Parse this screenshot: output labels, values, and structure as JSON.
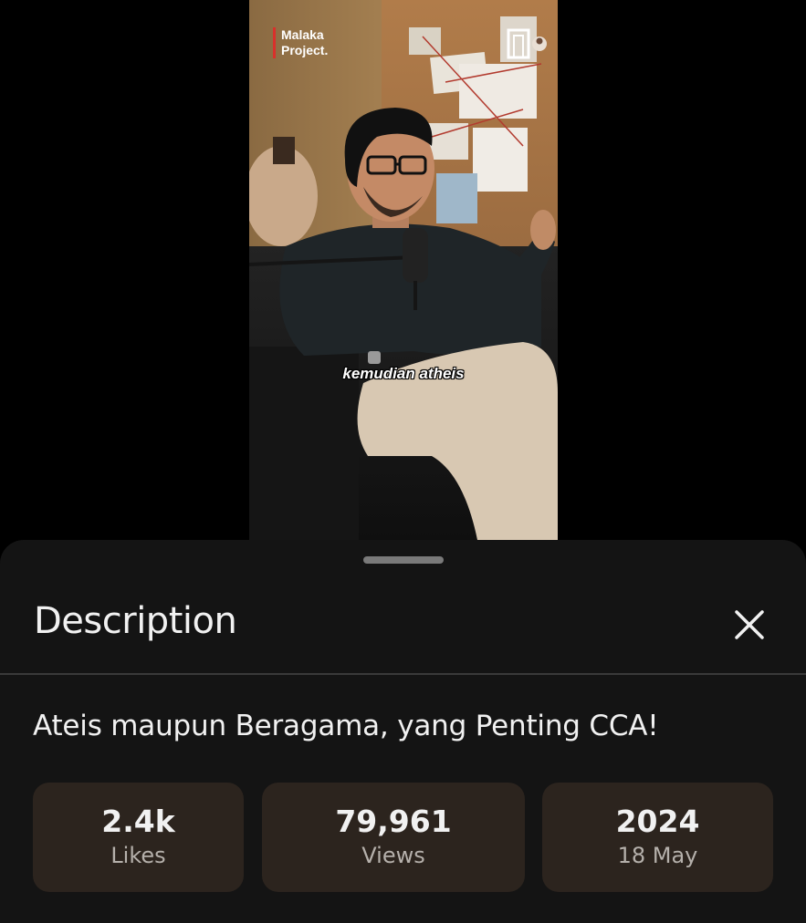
{
  "video": {
    "channel_logo_line1": "Malaka",
    "channel_logo_line2": "Project.",
    "caption": "kemudian atheis"
  },
  "description_sheet": {
    "title": "Description",
    "close_icon": "close-icon",
    "video_title": "Ateis maupun Beragama, yang Penting CCA!",
    "stats": {
      "likes_value": "2.4k",
      "likes_label": "Likes",
      "views_value": "79,961",
      "views_label": "Views",
      "year_value": "2024",
      "date_label": "18 May"
    }
  },
  "colors": {
    "sheet_background": "#141414",
    "stat_card_background": "#2c241e",
    "primary_text": "#f1f1f1",
    "secondary_text": "#b5b0ab",
    "logo_accent": "#d9302b"
  }
}
